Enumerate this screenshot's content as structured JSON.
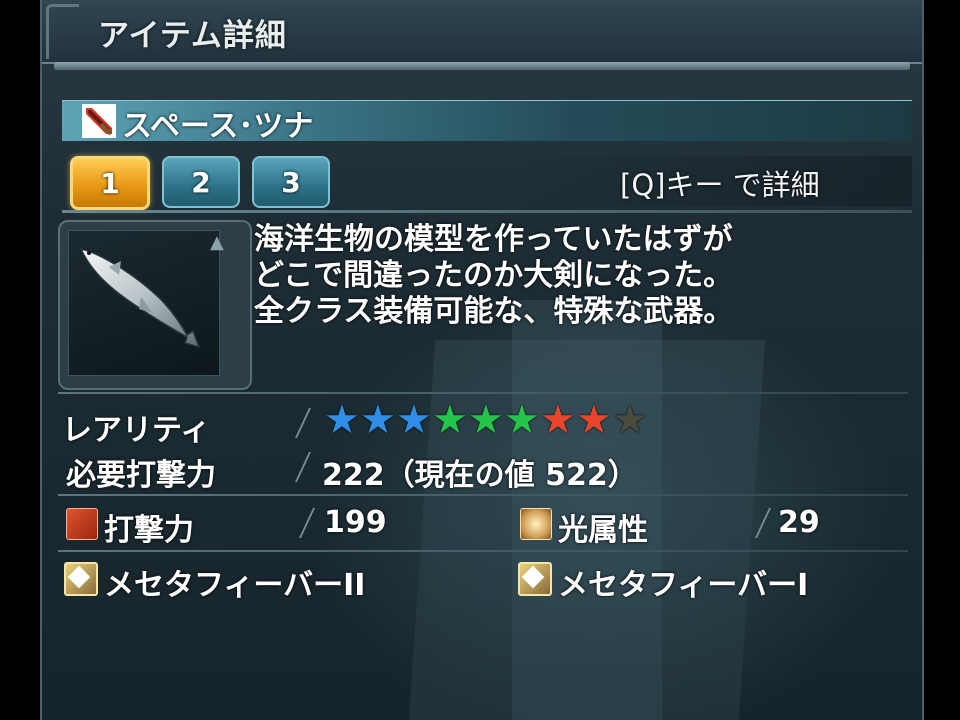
{
  "header": {
    "title": "アイテム詳細"
  },
  "item": {
    "name": "スペース･ツナ"
  },
  "tabs": [
    {
      "label": "1",
      "active": true
    },
    {
      "label": "2",
      "active": false
    },
    {
      "label": "3",
      "active": false
    }
  ],
  "hint": "[Q]キー で詳細",
  "description": [
    "海洋生物の模型を作っていたはずが",
    "どこで間違ったのか大剣になった。",
    "全クラス装備可能な、特殊な武器。"
  ],
  "rarity": {
    "label": "レアリティ",
    "value": 8,
    "max": 9,
    "star_colors": [
      "#2f8fe6",
      "#2f8fe6",
      "#2f8fe6",
      "#25c44a",
      "#25c44a",
      "#25c44a",
      "#e8462a",
      "#e8462a",
      "#4a4a3e"
    ]
  },
  "required": {
    "label": "必要打撃力",
    "value": "222（現在の値 522）"
  },
  "stats": {
    "attack": {
      "label": "打撃力",
      "value": "199",
      "icon": "sword-attack-icon"
    },
    "element": {
      "label": "光属性",
      "value": "29",
      "icon": "light-element-icon"
    }
  },
  "affixes": [
    {
      "label": "メセタフィーバーII",
      "icon": "affix-icon"
    },
    {
      "label": "メセタフィーバーI",
      "icon": "affix-icon"
    }
  ]
}
